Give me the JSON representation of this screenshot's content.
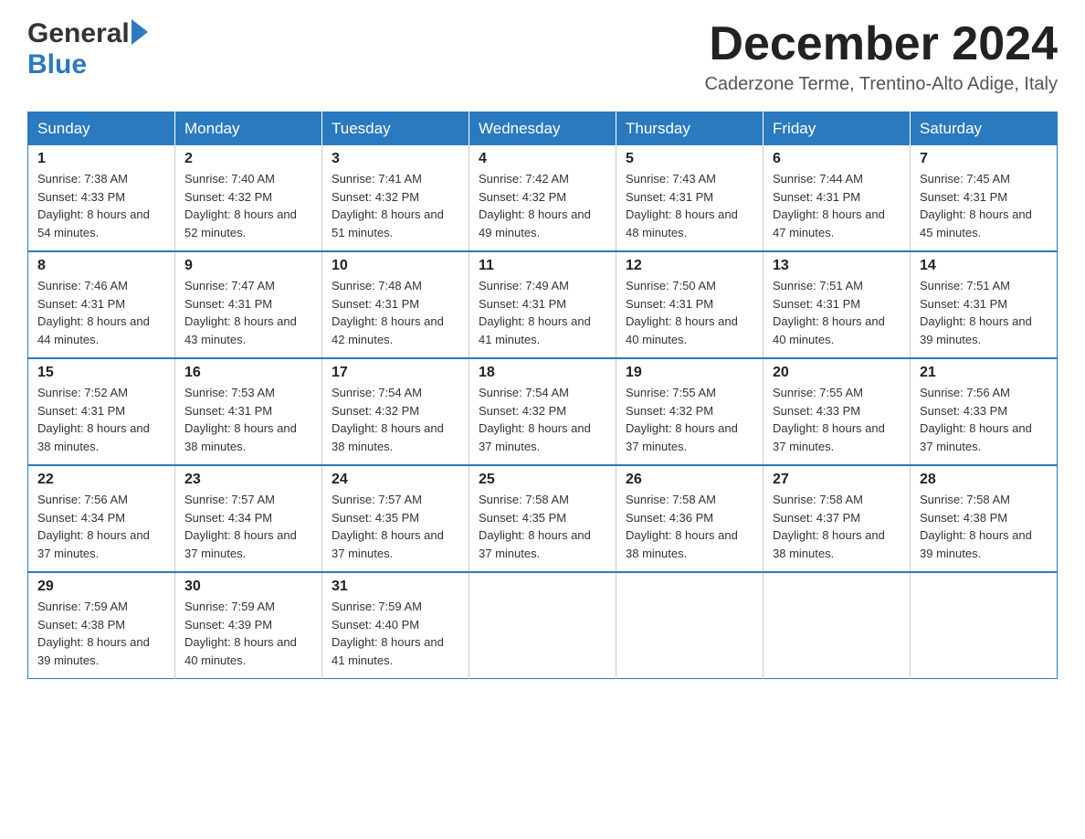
{
  "header": {
    "logo_text1": "General",
    "logo_text2": "Blue",
    "month_title": "December 2024",
    "location": "Caderzone Terme, Trentino-Alto Adige, Italy"
  },
  "weekdays": [
    "Sunday",
    "Monday",
    "Tuesday",
    "Wednesday",
    "Thursday",
    "Friday",
    "Saturday"
  ],
  "weeks": [
    [
      {
        "day": "1",
        "sunrise": "7:38 AM",
        "sunset": "4:33 PM",
        "daylight": "8 hours and 54 minutes."
      },
      {
        "day": "2",
        "sunrise": "7:40 AM",
        "sunset": "4:32 PM",
        "daylight": "8 hours and 52 minutes."
      },
      {
        "day": "3",
        "sunrise": "7:41 AM",
        "sunset": "4:32 PM",
        "daylight": "8 hours and 51 minutes."
      },
      {
        "day": "4",
        "sunrise": "7:42 AM",
        "sunset": "4:32 PM",
        "daylight": "8 hours and 49 minutes."
      },
      {
        "day": "5",
        "sunrise": "7:43 AM",
        "sunset": "4:31 PM",
        "daylight": "8 hours and 48 minutes."
      },
      {
        "day": "6",
        "sunrise": "7:44 AM",
        "sunset": "4:31 PM",
        "daylight": "8 hours and 47 minutes."
      },
      {
        "day": "7",
        "sunrise": "7:45 AM",
        "sunset": "4:31 PM",
        "daylight": "8 hours and 45 minutes."
      }
    ],
    [
      {
        "day": "8",
        "sunrise": "7:46 AM",
        "sunset": "4:31 PM",
        "daylight": "8 hours and 44 minutes."
      },
      {
        "day": "9",
        "sunrise": "7:47 AM",
        "sunset": "4:31 PM",
        "daylight": "8 hours and 43 minutes."
      },
      {
        "day": "10",
        "sunrise": "7:48 AM",
        "sunset": "4:31 PM",
        "daylight": "8 hours and 42 minutes."
      },
      {
        "day": "11",
        "sunrise": "7:49 AM",
        "sunset": "4:31 PM",
        "daylight": "8 hours and 41 minutes."
      },
      {
        "day": "12",
        "sunrise": "7:50 AM",
        "sunset": "4:31 PM",
        "daylight": "8 hours and 40 minutes."
      },
      {
        "day": "13",
        "sunrise": "7:51 AM",
        "sunset": "4:31 PM",
        "daylight": "8 hours and 40 minutes."
      },
      {
        "day": "14",
        "sunrise": "7:51 AM",
        "sunset": "4:31 PM",
        "daylight": "8 hours and 39 minutes."
      }
    ],
    [
      {
        "day": "15",
        "sunrise": "7:52 AM",
        "sunset": "4:31 PM",
        "daylight": "8 hours and 38 minutes."
      },
      {
        "day": "16",
        "sunrise": "7:53 AM",
        "sunset": "4:31 PM",
        "daylight": "8 hours and 38 minutes."
      },
      {
        "day": "17",
        "sunrise": "7:54 AM",
        "sunset": "4:32 PM",
        "daylight": "8 hours and 38 minutes."
      },
      {
        "day": "18",
        "sunrise": "7:54 AM",
        "sunset": "4:32 PM",
        "daylight": "8 hours and 37 minutes."
      },
      {
        "day": "19",
        "sunrise": "7:55 AM",
        "sunset": "4:32 PM",
        "daylight": "8 hours and 37 minutes."
      },
      {
        "day": "20",
        "sunrise": "7:55 AM",
        "sunset": "4:33 PM",
        "daylight": "8 hours and 37 minutes."
      },
      {
        "day": "21",
        "sunrise": "7:56 AM",
        "sunset": "4:33 PM",
        "daylight": "8 hours and 37 minutes."
      }
    ],
    [
      {
        "day": "22",
        "sunrise": "7:56 AM",
        "sunset": "4:34 PM",
        "daylight": "8 hours and 37 minutes."
      },
      {
        "day": "23",
        "sunrise": "7:57 AM",
        "sunset": "4:34 PM",
        "daylight": "8 hours and 37 minutes."
      },
      {
        "day": "24",
        "sunrise": "7:57 AM",
        "sunset": "4:35 PM",
        "daylight": "8 hours and 37 minutes."
      },
      {
        "day": "25",
        "sunrise": "7:58 AM",
        "sunset": "4:35 PM",
        "daylight": "8 hours and 37 minutes."
      },
      {
        "day": "26",
        "sunrise": "7:58 AM",
        "sunset": "4:36 PM",
        "daylight": "8 hours and 38 minutes."
      },
      {
        "day": "27",
        "sunrise": "7:58 AM",
        "sunset": "4:37 PM",
        "daylight": "8 hours and 38 minutes."
      },
      {
        "day": "28",
        "sunrise": "7:58 AM",
        "sunset": "4:38 PM",
        "daylight": "8 hours and 39 minutes."
      }
    ],
    [
      {
        "day": "29",
        "sunrise": "7:59 AM",
        "sunset": "4:38 PM",
        "daylight": "8 hours and 39 minutes."
      },
      {
        "day": "30",
        "sunrise": "7:59 AM",
        "sunset": "4:39 PM",
        "daylight": "8 hours and 40 minutes."
      },
      {
        "day": "31",
        "sunrise": "7:59 AM",
        "sunset": "4:40 PM",
        "daylight": "8 hours and 41 minutes."
      },
      null,
      null,
      null,
      null
    ]
  ],
  "labels": {
    "sunrise": "Sunrise:",
    "sunset": "Sunset:",
    "daylight": "Daylight:"
  },
  "colors": {
    "header_bg": "#2a7abf",
    "border": "#2a7abf"
  }
}
